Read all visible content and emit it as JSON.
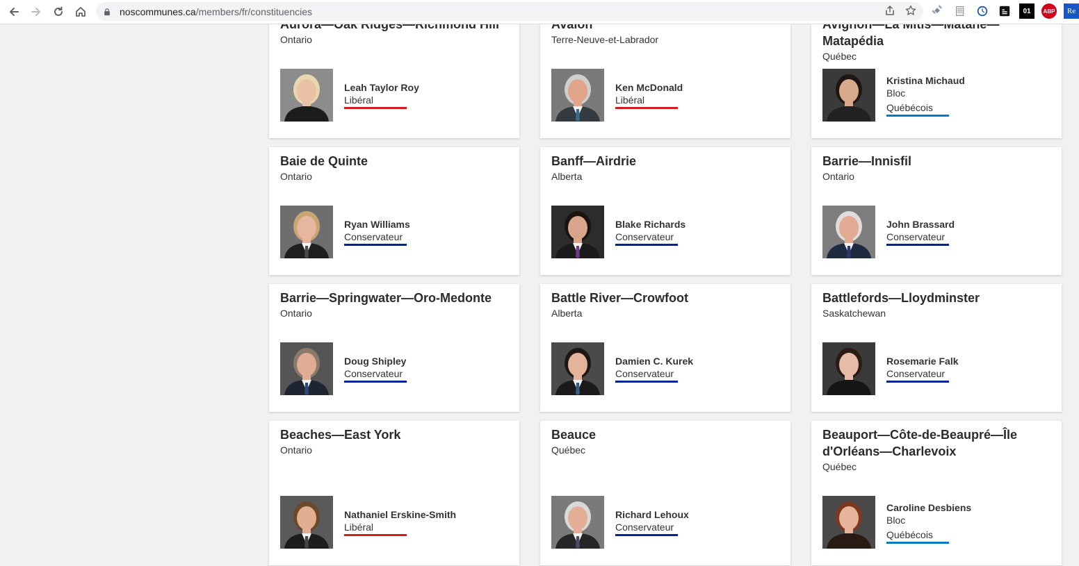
{
  "browser": {
    "url_host": "noscommunes.ca",
    "url_path": "/members/fr/constituencies",
    "extensions": [
      {
        "name": "satellite-icon",
        "label": ""
      },
      {
        "name": "document-icon",
        "label": ""
      },
      {
        "name": "clock-icon",
        "label": ""
      },
      {
        "name": "rss-icon",
        "label": ""
      },
      {
        "name": "01net-icon",
        "label": "01"
      },
      {
        "name": "adblock-icon",
        "label": "ABP"
      },
      {
        "name": "reader-icon",
        "label": "Re"
      }
    ]
  },
  "parties": {
    "liberal": {
      "color": "#d71920"
    },
    "conservative": {
      "color": "#002395"
    },
    "bloc": {
      "color": "#0a7abf"
    }
  },
  "cards": [
    {
      "riding": "Aurora—Oak Ridges—Richmond Hill",
      "province": "Ontario",
      "member": "Leah Taylor Roy",
      "party_lines": [
        "Libéral"
      ],
      "party": "liberal",
      "photo": {
        "bg": "#8c8c8c",
        "hair": "#e8d6b0",
        "skin": "#e9c2a5",
        "suit": "#1c1c1c",
        "tie": "none"
      }
    },
    {
      "riding": "Avalon",
      "province": "Terre-Neuve-et-Labrador",
      "member": "Ken McDonald",
      "party_lines": [
        "Libéral"
      ],
      "party": "liberal",
      "photo": {
        "bg": "#7a7a7a",
        "hair": "#cfcfcf",
        "skin": "#e0a58a",
        "suit": "#333a40",
        "tie": "#3a6a8a"
      }
    },
    {
      "riding": "Avignon—La Mitis—Matane—Matapédia",
      "province": "Québec",
      "member": "Kristina Michaud",
      "party_lines": [
        "Bloc",
        "Québécois"
      ],
      "party": "bloc",
      "photo": {
        "bg": "#3a3a3a",
        "hair": "#1e1612",
        "skin": "#d9a98c",
        "suit": "#222222",
        "tie": "none"
      }
    },
    {
      "riding": "Baie de Quinte",
      "province": "Ontario",
      "member": "Ryan Williams",
      "party_lines": [
        "Conservateur"
      ],
      "party": "conservative",
      "photo": {
        "bg": "#6e6e6e",
        "hair": "#c9a574",
        "skin": "#e6b79e",
        "suit": "#1f1f1f",
        "tie": "#4a4a4a"
      }
    },
    {
      "riding": "Banff—Airdrie",
      "province": "Alberta",
      "member": "Blake Richards",
      "party_lines": [
        "Conservateur"
      ],
      "party": "conservative",
      "photo": {
        "bg": "#2c2c2c",
        "hair": "#1a1410",
        "skin": "#d9a58a",
        "suit": "#1a1a1a",
        "tie": "#6a3a8a"
      }
    },
    {
      "riding": "Barrie—Innisfil",
      "province": "Ontario",
      "member": "John Brassard",
      "party_lines": [
        "Conservateur"
      ],
      "party": "conservative",
      "photo": {
        "bg": "#7d7d7d",
        "hair": "#dddddd",
        "skin": "#e2aa92",
        "suit": "#1d2a40",
        "tie": "#2a3a6a"
      }
    },
    {
      "riding": "Barrie—Springwater—Oro-Medonte",
      "province": "Ontario",
      "member": "Doug Shipley",
      "party_lines": [
        "Conservateur"
      ],
      "party": "conservative",
      "photo": {
        "bg": "#555555",
        "hair": "#8a7a6a",
        "skin": "#e0ad94",
        "suit": "#1f2530",
        "tie": "#2a4a7a"
      }
    },
    {
      "riding": "Battle River—Crowfoot",
      "province": "Alberta",
      "member": "Damien C. Kurek",
      "party_lines": [
        "Conservateur"
      ],
      "party": "conservative",
      "photo": {
        "bg": "#4a4a4a",
        "hair": "#1e1812",
        "skin": "#e3b39a",
        "suit": "#1a1a1a",
        "tie": "#3a5a8a"
      }
    },
    {
      "riding": "Battlefords—Lloydminster",
      "province": "Saskatchewan",
      "member": "Rosemarie Falk",
      "party_lines": [
        "Conservateur"
      ],
      "party": "conservative",
      "photo": {
        "bg": "#3a3a3a",
        "hair": "#2a1c14",
        "skin": "#e6bca6",
        "suit": "#151515",
        "tie": "none"
      }
    },
    {
      "riding": "Beaches—East York",
      "province": "Ontario",
      "member": "Nathaniel Erskine-Smith",
      "party_lines": [
        "Libéral"
      ],
      "party": "liberal",
      "photo": {
        "bg": "#5a5a5a",
        "hair": "#6a4a2a",
        "skin": "#e2ae92",
        "suit": "#1c1c1c",
        "tie": "#444444"
      }
    },
    {
      "riding": "Beauce",
      "province": "Québec",
      "member": "Richard Lehoux",
      "party_lines": [
        "Conservateur"
      ],
      "party": "conservative",
      "photo": {
        "bg": "#7a7a7a",
        "hair": "#d9d9d9",
        "skin": "#e4ae96",
        "suit": "#262626",
        "tie": "#4a4a6a"
      }
    },
    {
      "riding": "Beauport—Côte-de-Beaupré—Île d'Orléans—Charlevoix",
      "province": "Québec",
      "member": "Caroline Desbiens",
      "party_lines": [
        "Bloc",
        "Québécois"
      ],
      "party": "bloc",
      "photo": {
        "bg": "#4a4a4a",
        "hair": "#7a3a20",
        "skin": "#e6b49a",
        "suit": "#2a1a14",
        "tie": "none"
      }
    }
  ]
}
